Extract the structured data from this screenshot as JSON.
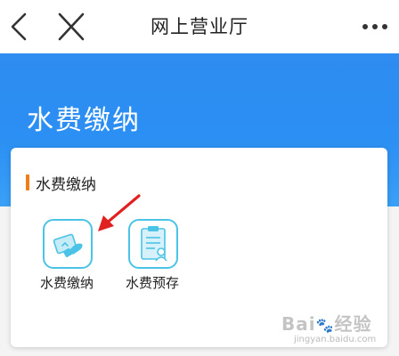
{
  "header": {
    "title": "网上营业厅",
    "back_icon": "chevron-left-icon",
    "close_icon": "close-icon",
    "more_icon": "more-dots-icon"
  },
  "banner": {
    "title": "水费缴纳"
  },
  "section": {
    "title": "水费缴纳",
    "accent_color": "#ef7d1a",
    "items": [
      {
        "label": "水费缴纳",
        "icon": "water-payment-icon"
      },
      {
        "label": "水费预存",
        "icon": "water-prestore-icon"
      }
    ]
  },
  "annotation": {
    "arrow_color": "#e12020"
  },
  "watermark": {
    "logo": "Bai",
    "logo_suffix": "经验",
    "url": "jingyan.baidu.com"
  },
  "colors": {
    "banner": "#2f8cf0",
    "icon_border": "#4bc3e6"
  }
}
